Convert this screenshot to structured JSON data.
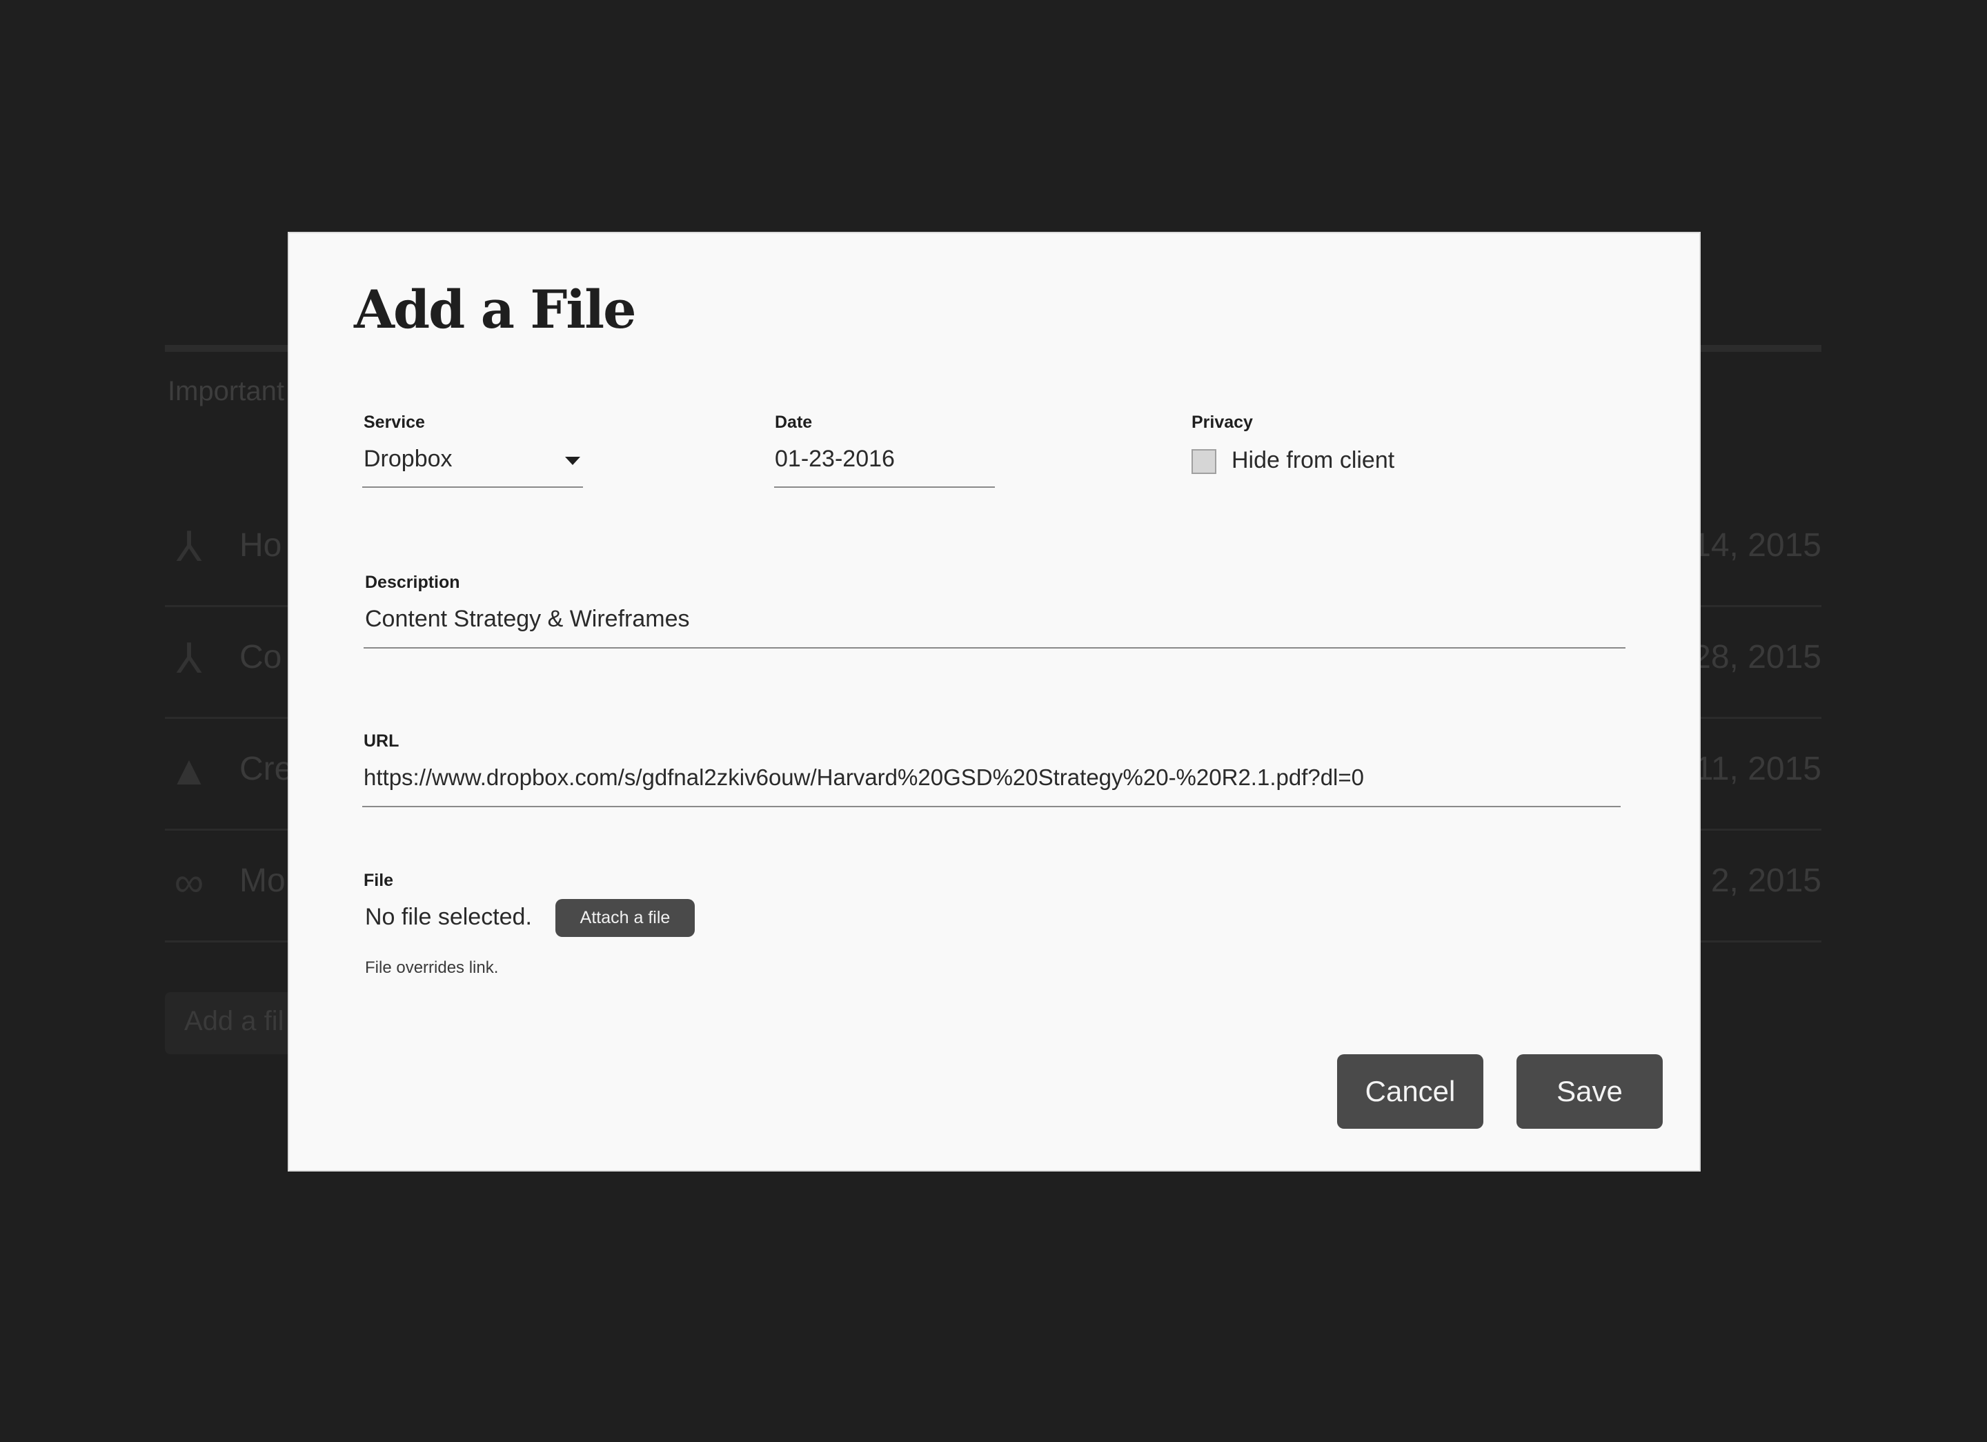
{
  "background": {
    "section_label": "Important",
    "rows": [
      {
        "icon": "pdf-icon",
        "name": "Ho",
        "date": "14, 2015"
      },
      {
        "icon": "pdf-icon",
        "name": "Co",
        "date": "28, 2015"
      },
      {
        "icon": "drive-icon",
        "name": "Cre",
        "date": "11, 2015"
      },
      {
        "icon": "link-icon",
        "name": "Mo",
        "date": "2, 2015"
      }
    ],
    "add_button_label": "Add a fil"
  },
  "modal": {
    "title": "Add a File",
    "service": {
      "label": "Service",
      "value": "Dropbox"
    },
    "date": {
      "label": "Date",
      "value": "01-23-2016"
    },
    "privacy": {
      "label": "Privacy",
      "checkbox_label": "Hide from client",
      "checked": false
    },
    "description": {
      "label": "Description",
      "value": "Content Strategy & Wireframes"
    },
    "url": {
      "label": "URL",
      "value": "https://www.dropbox.com/s/gdfnal2zkiv6ouw/Harvard%20GSD%20Strategy%20-%20R2.1.pdf?dl=0"
    },
    "file": {
      "label": "File",
      "status": "No file selected.",
      "attach_button": "Attach a file",
      "hint": "File overrides link."
    },
    "cancel_button": "Cancel",
    "save_button": "Save"
  },
  "colors": {
    "page_background": "#1f1f1f",
    "modal_background": "#f9f9f9",
    "button_background": "#4a4a4a",
    "text": "#1f1f1f"
  }
}
